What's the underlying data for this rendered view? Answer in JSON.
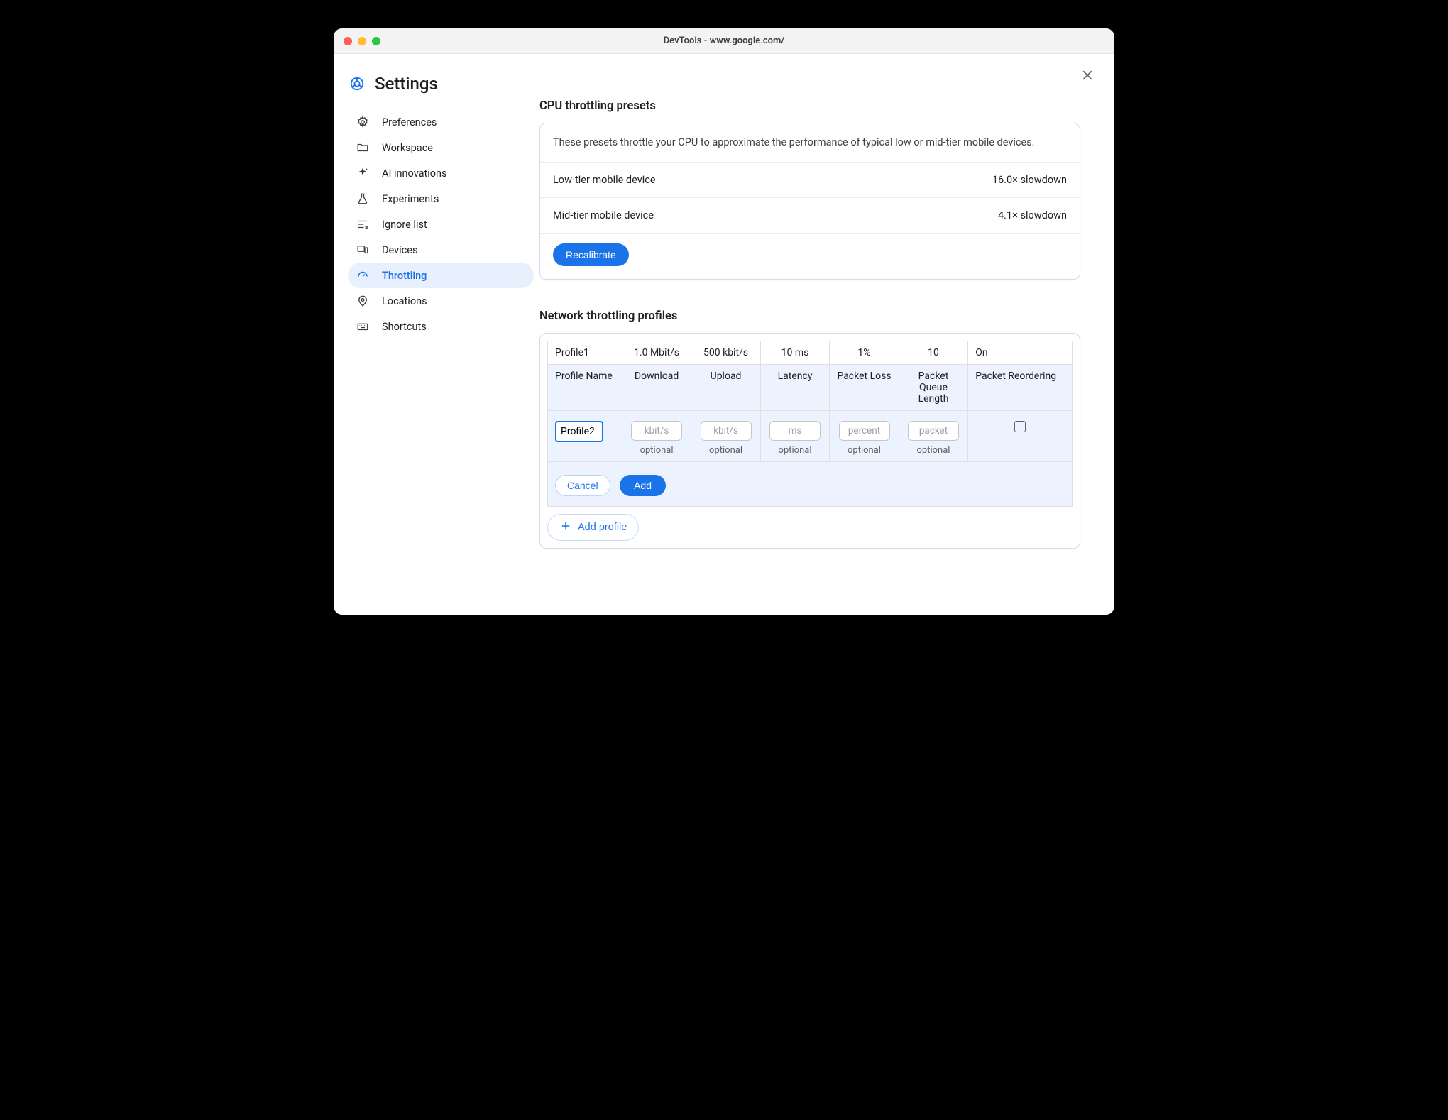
{
  "window": {
    "title": "DevTools - www.google.com/"
  },
  "header": {
    "title": "Settings"
  },
  "sidebar": {
    "items": [
      {
        "label": "Preferences"
      },
      {
        "label": "Workspace"
      },
      {
        "label": "AI innovations"
      },
      {
        "label": "Experiments"
      },
      {
        "label": "Ignore list"
      },
      {
        "label": "Devices"
      },
      {
        "label": "Throttling"
      },
      {
        "label": "Locations"
      },
      {
        "label": "Shortcuts"
      }
    ]
  },
  "cpu": {
    "title": "CPU throttling presets",
    "description": "These presets throttle your CPU to approximate the performance of typical low or mid-tier mobile devices.",
    "presets": [
      {
        "name": "Low-tier mobile device",
        "value": "16.0× slowdown"
      },
      {
        "name": "Mid-tier mobile device",
        "value": "4.1× slowdown"
      }
    ],
    "recalibrate": "Recalibrate"
  },
  "network": {
    "title": "Network throttling profiles",
    "columns": {
      "name": "Profile Name",
      "download": "Download",
      "upload": "Upload",
      "latency": "Latency",
      "loss": "Packet Loss",
      "queue": "Packet Queue Length",
      "reorder": "Packet Reordering"
    },
    "rows": [
      {
        "name": "Profile1",
        "download": "1.0 Mbit/s",
        "upload": "500 kbit/s",
        "latency": "10 ms",
        "loss": "1%",
        "queue": "10",
        "reorder": "On"
      }
    ],
    "form": {
      "name_value": "Profile2",
      "placeholders": {
        "download": "kbit/s",
        "upload": "kbit/s",
        "latency": "ms",
        "loss": "percent",
        "queue": "packet"
      },
      "optional": "optional",
      "cancel": "Cancel",
      "add": "Add"
    },
    "add_profile": "Add profile"
  }
}
